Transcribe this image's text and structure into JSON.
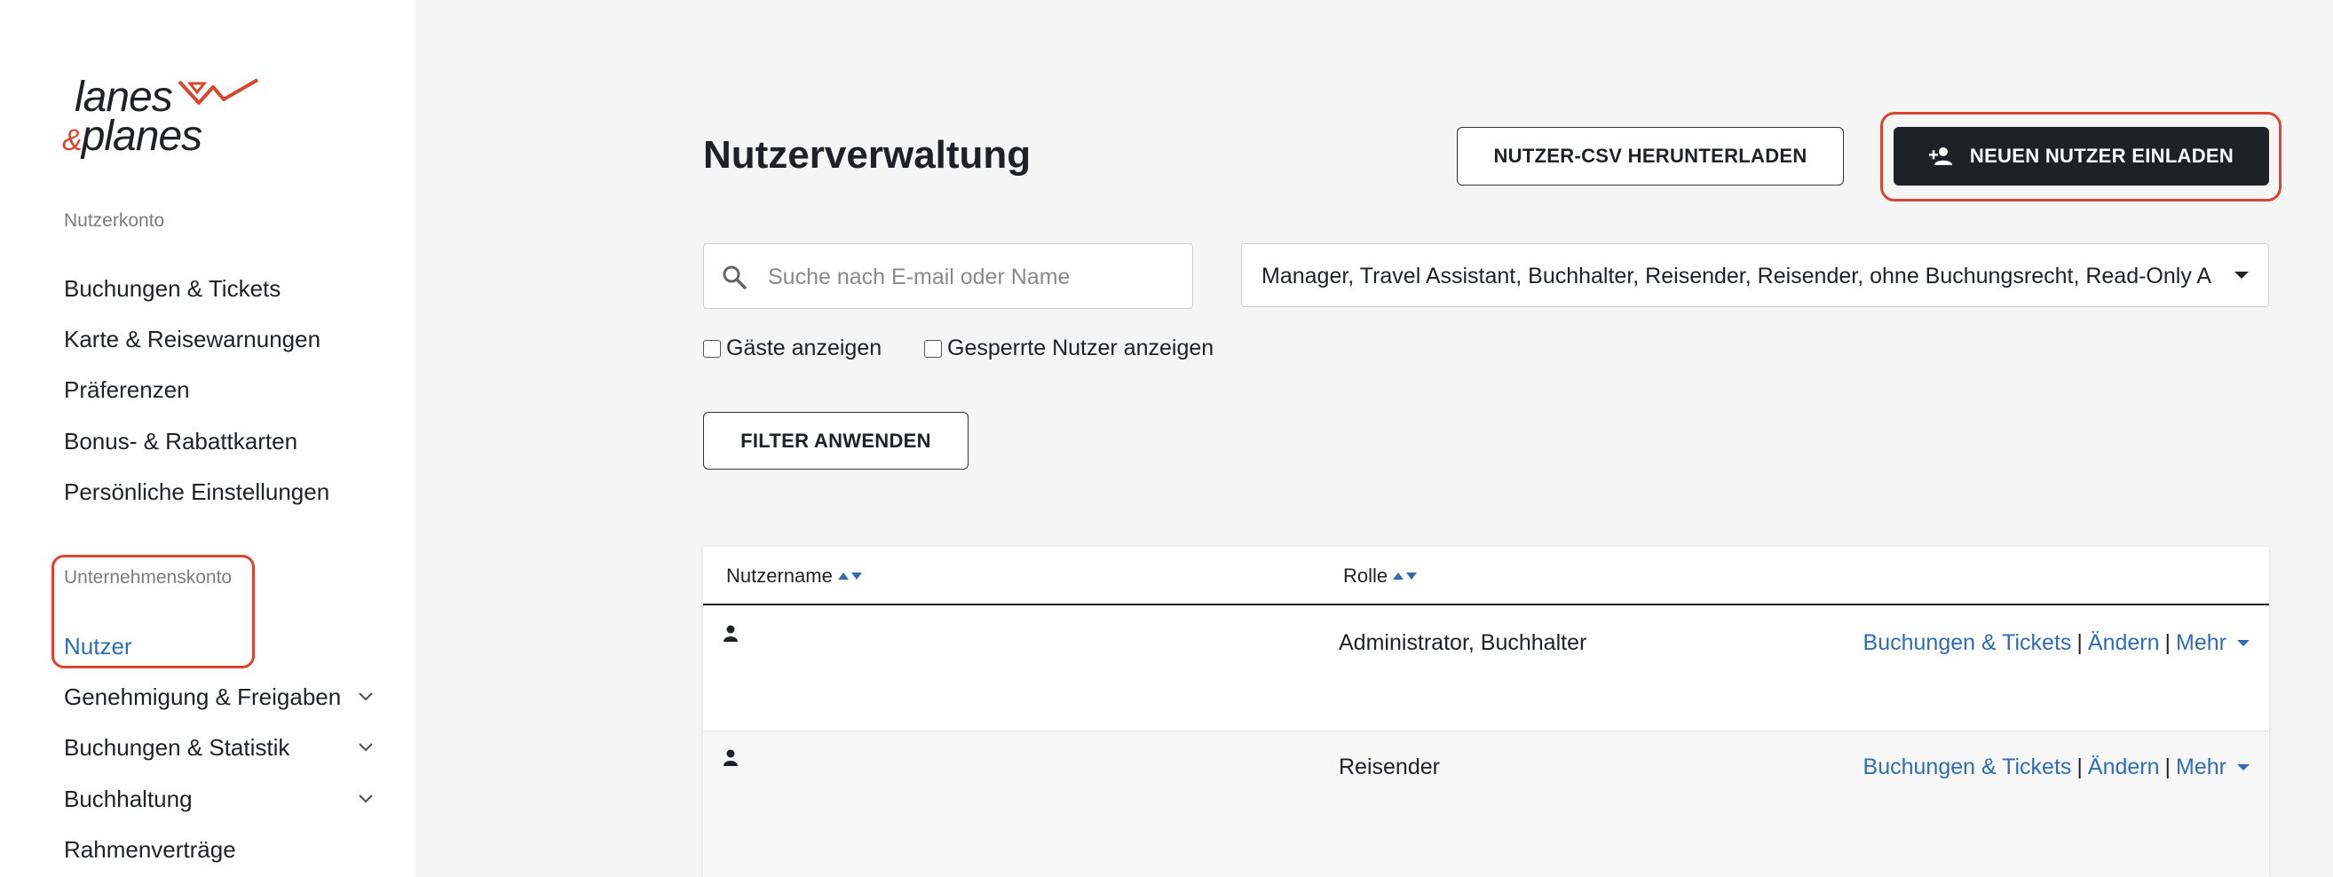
{
  "brand": {
    "logo_line1": "lanes",
    "logo_amp": "&",
    "logo_line2": "planes",
    "accent": "#d9452e",
    "link_color": "#2e6db4"
  },
  "sidebar": {
    "account_label": "Nutzerkonto",
    "account_items": [
      {
        "label": "Buchungen & Tickets"
      },
      {
        "label": "Karte & Reisewarnungen"
      },
      {
        "label": "Präferenzen"
      },
      {
        "label": "Bonus- & Rabattkarten"
      },
      {
        "label": "Persönliche Einstellungen"
      }
    ],
    "company_label": "Unternehmenskonto",
    "company_items": [
      {
        "label": "Nutzer",
        "active": true
      },
      {
        "label": "Genehmigung & Freigaben",
        "expandable": true
      },
      {
        "label": "Buchungen & Statistik",
        "expandable": true
      },
      {
        "label": "Buchhaltung",
        "expandable": true
      },
      {
        "label": "Rahmenverträge"
      }
    ]
  },
  "main": {
    "title": "Nutzerverwaltung",
    "csv_button": "NUTZER-CSV HERUNTERLADEN",
    "invite_button": "NEUEN NUTZER EINLADEN",
    "search": {
      "placeholder": "Suche nach E-mail oder Name",
      "value": ""
    },
    "role_filter": "Manager, Travel Assistant, Buchhalter, Reisender, Reisender, ohne Buchungsrecht, Read-Only A",
    "checkboxes": [
      {
        "label": "Gäste anzeigen",
        "checked": false
      },
      {
        "label": "Gesperrte Nutzer anzeigen",
        "checked": false
      }
    ],
    "apply_button": "FILTER ANWENDEN"
  },
  "table": {
    "columns": [
      "Nutzername",
      "Rolle"
    ],
    "rows": [
      {
        "role": "Administrator, Buchhalter"
      },
      {
        "role": "Reisender"
      }
    ],
    "actions": {
      "bookings": "Buchungen & Tickets",
      "separator": "|",
      "edit": "Ändern",
      "more": "Mehr"
    }
  }
}
